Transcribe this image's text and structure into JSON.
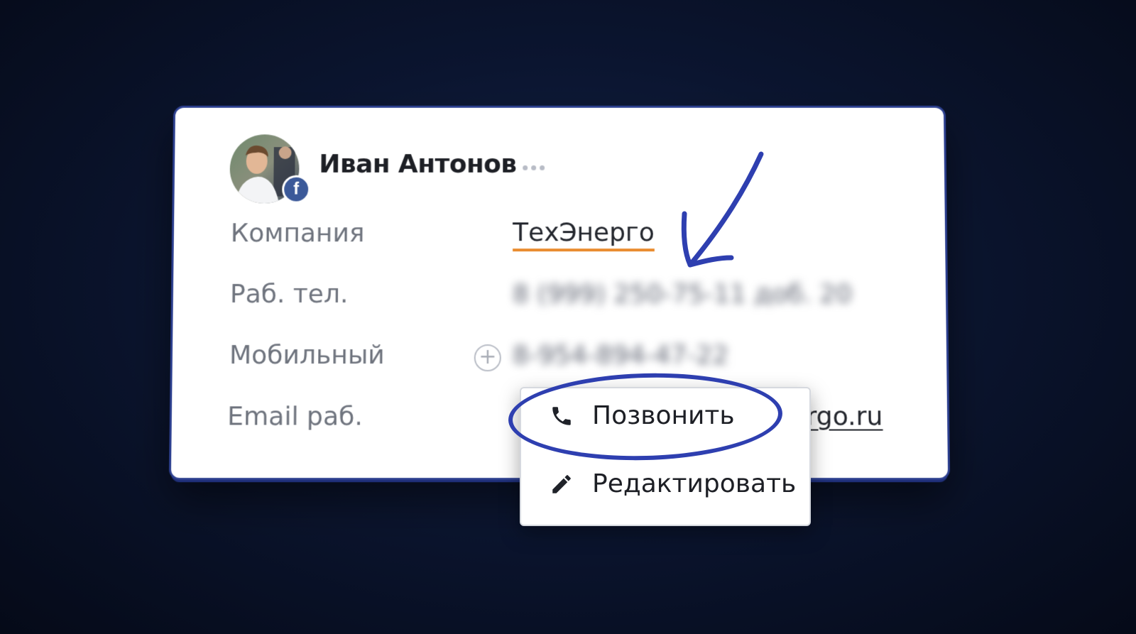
{
  "contact": {
    "name": "Иван Антонов",
    "social_badge": "f",
    "fields": {
      "company": {
        "label": "Компания",
        "value": "ТехЭнерго"
      },
      "work_phone": {
        "label": "Раб. тел.",
        "value": "8 (999) 250-75-11 доб. 20"
      },
      "mobile": {
        "label": "Мобильный",
        "value": "8-954-894-47-22"
      },
      "work_email": {
        "label": "Email раб.",
        "value": "ergo.ru"
      }
    }
  },
  "context_menu": {
    "items": [
      {
        "label": "Позвонить",
        "icon": "phone-icon"
      },
      {
        "label": "Редактировать",
        "icon": "pencil-icon"
      }
    ]
  },
  "colors": {
    "accent_underline": "#e98a2c",
    "annotation": "#2e3fb0",
    "facebook": "#3b5999"
  }
}
